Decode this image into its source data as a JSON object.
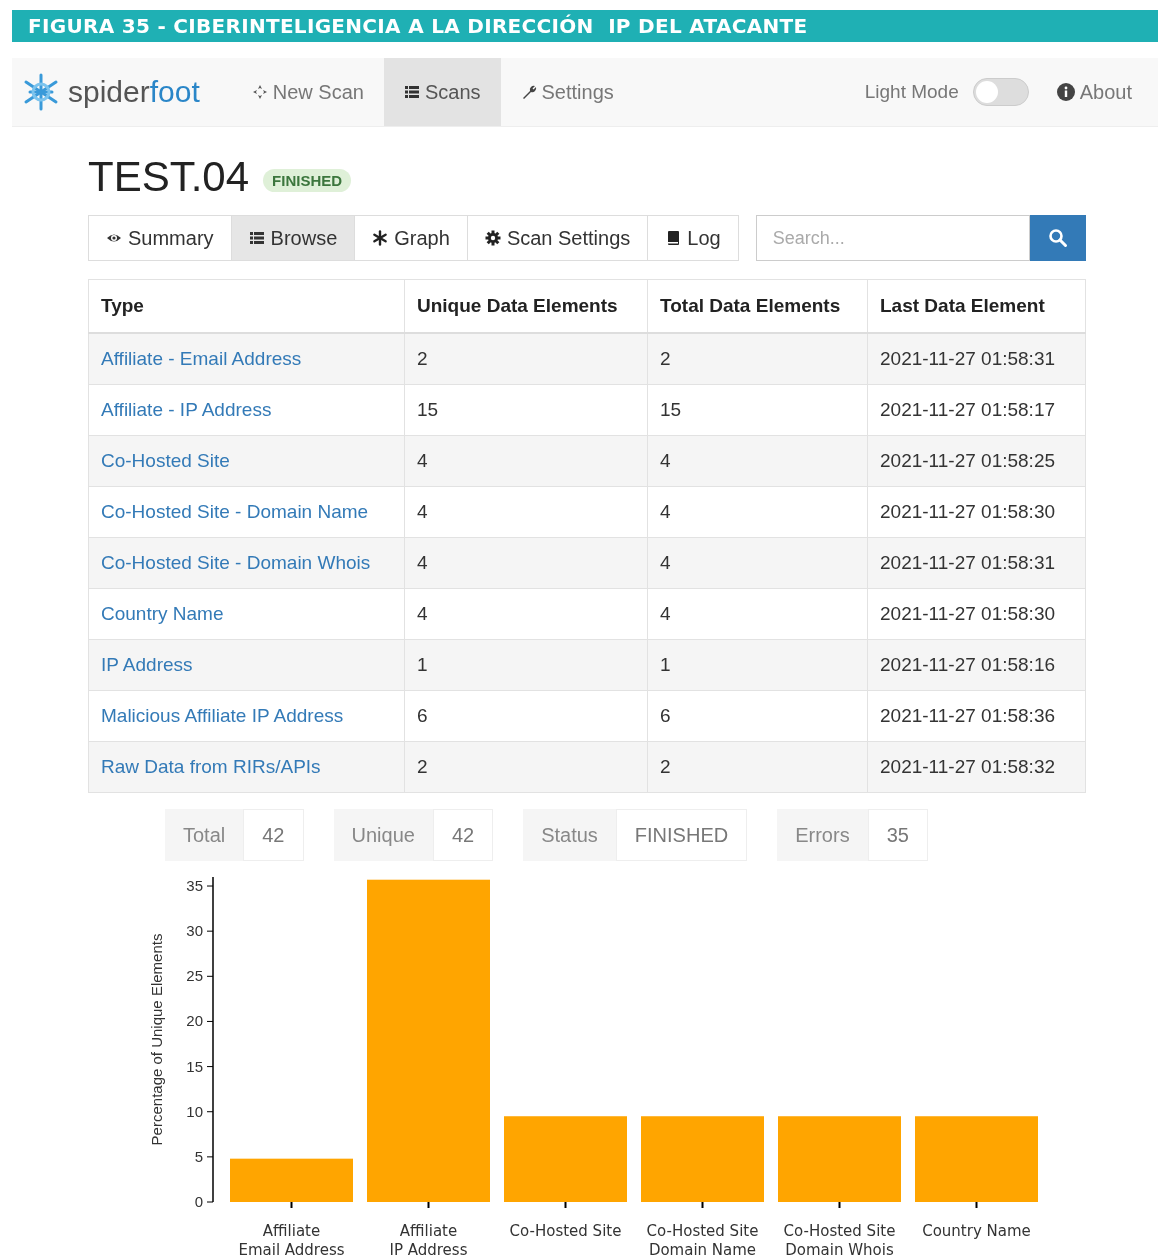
{
  "figure_caption": "FIGURA 35 - CIBERINTELIGENCIA A LA DIRECCIÓN  IP DEL ATACANTE",
  "navbar": {
    "brand": {
      "part1": "spider",
      "part2": "foot"
    },
    "items": [
      {
        "label": "New Scan",
        "kind": "crosshair",
        "selected": false
      },
      {
        "label": "Scans",
        "kind": "list",
        "selected": true
      },
      {
        "label": "Settings",
        "kind": "wrench",
        "selected": false
      }
    ],
    "light_mode": {
      "label": "Light Mode",
      "on": false
    },
    "about": "About"
  },
  "scan": {
    "title": "TEST.04",
    "status_badge": "FINISHED"
  },
  "tabs": [
    {
      "label": "Summary",
      "kind": "eye",
      "selected": false
    },
    {
      "label": "Browse",
      "kind": "list",
      "selected": true
    },
    {
      "label": "Graph",
      "kind": "asterisk",
      "selected": false
    },
    {
      "label": "Scan Settings",
      "kind": "gear",
      "selected": false
    },
    {
      "label": "Log",
      "kind": "book",
      "selected": false
    }
  ],
  "search": {
    "placeholder": "Search..."
  },
  "table": {
    "columns": [
      "Type",
      "Unique Data Elements",
      "Total Data Elements",
      "Last Data Element"
    ],
    "rows": [
      [
        "Affiliate - Email Address",
        "2",
        "2",
        "2021-11-27 01:58:31"
      ],
      [
        "Affiliate - IP Address",
        "15",
        "15",
        "2021-11-27 01:58:17"
      ],
      [
        "Co-Hosted Site",
        "4",
        "4",
        "2021-11-27 01:58:25"
      ],
      [
        "Co-Hosted Site - Domain Name",
        "4",
        "4",
        "2021-11-27 01:58:30"
      ],
      [
        "Co-Hosted Site - Domain Whois",
        "4",
        "4",
        "2021-11-27 01:58:31"
      ],
      [
        "Country Name",
        "4",
        "4",
        "2021-11-27 01:58:30"
      ],
      [
        "IP Address",
        "1",
        "1",
        "2021-11-27 01:58:16"
      ],
      [
        "Malicious Affiliate IP Address",
        "6",
        "6",
        "2021-11-27 01:58:36"
      ],
      [
        "Raw Data from RIRs/APIs",
        "2",
        "2",
        "2021-11-27 01:58:32"
      ]
    ]
  },
  "stats": [
    {
      "label": "Total",
      "value": "42"
    },
    {
      "label": "Unique",
      "value": "42"
    },
    {
      "label": "Status",
      "value": "FINISHED"
    },
    {
      "label": "Errors",
      "value": "35"
    }
  ],
  "chart": {
    "chart_data": {
      "type": "bar",
      "ylabel": "Percentage of Unique Elements",
      "categories": [
        "Affiliate\nEmail Address",
        "Affiliate\nIP Address",
        "Co-Hosted Site",
        "Co-Hosted Site\nDomain Name",
        "Co-Hosted Site\nDomain Whois",
        "Country Name"
      ],
      "values": [
        4.8,
        35.7,
        9.5,
        9.5,
        9.5,
        9.5
      ],
      "ylim": [
        0,
        36
      ],
      "yticks": [
        0,
        5,
        10,
        15,
        20,
        25,
        30,
        35
      ]
    }
  }
}
